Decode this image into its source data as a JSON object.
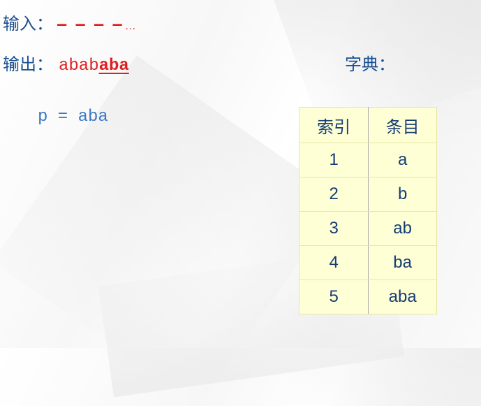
{
  "input": {
    "label": "输入：",
    "dashes": "– – – –",
    "ellipsis": "…"
  },
  "output": {
    "label": "输出：",
    "plain": "abab",
    "highlight": "aba"
  },
  "pattern": {
    "text": "p = aba"
  },
  "dictionary": {
    "title": "字典：",
    "headers": [
      "索引",
      "条目"
    ],
    "rows": [
      {
        "index": "1",
        "entry": "a"
      },
      {
        "index": "2",
        "entry": "b"
      },
      {
        "index": "3",
        "entry": "ab"
      },
      {
        "index": "4",
        "entry": "ba"
      },
      {
        "index": "5",
        "entry": "aba"
      }
    ]
  },
  "colors": {
    "label_blue": "#1a4f8f",
    "output_red": "#e02020",
    "pattern_blue": "#3b78c2",
    "table_fill": "#ffffd6"
  }
}
